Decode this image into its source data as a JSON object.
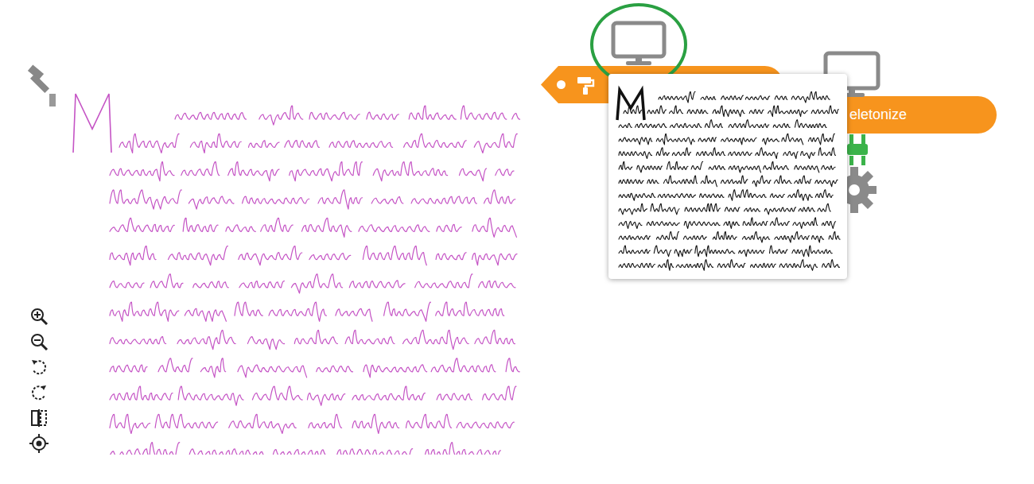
{
  "nodes": [
    {
      "highlighted": true
    },
    {
      "label": "eletonize",
      "highlighted": false
    }
  ],
  "preview": {
    "open": true
  }
}
